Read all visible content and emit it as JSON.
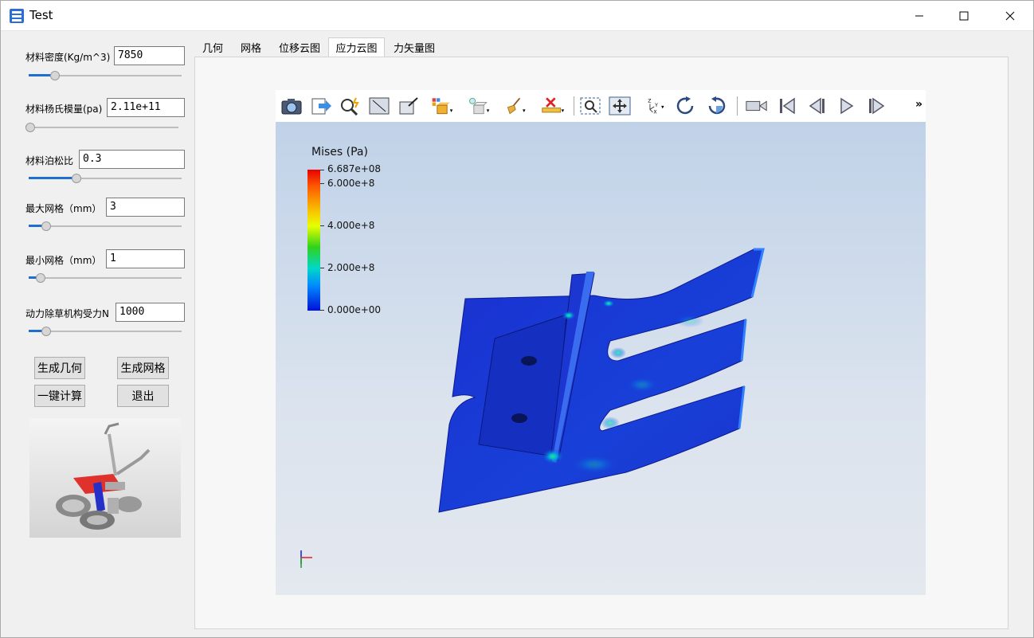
{
  "window": {
    "title": "Test"
  },
  "left_panel": {
    "density": {
      "label": "材料密度(Kg/m^3)",
      "value": "7850",
      "slider": 0.15
    },
    "young": {
      "label": "材料杨氏模量(pa)",
      "value": "2.11e+11",
      "slider": 0.0
    },
    "poisson": {
      "label": "材料泊松比",
      "value": "0.3",
      "slider": 0.3
    },
    "max_mesh": {
      "label": "最大网格（mm）",
      "value": "3",
      "slider": 0.09
    },
    "min_mesh": {
      "label": "最小网格（mm）",
      "value": "1",
      "slider": 0.05
    },
    "force": {
      "label": "动力除草机构受力N",
      "value": "1000",
      "slider": 0.09
    },
    "buttons": {
      "gen_geom": "生成几何",
      "gen_mesh": "生成网格",
      "compute": "一键计算",
      "exit": "退出"
    }
  },
  "tabs": [
    "几何",
    "网格",
    "位移云图",
    "应力云图",
    "力矢量图"
  ],
  "active_tab": "应力云图",
  "toolbar": {
    "icons": [
      "camera-icon",
      "export-icon",
      "zoom-magic-icon",
      "fit-frame-icon",
      "expand-frame-icon",
      "display-mode-icon",
      "lighting-icon",
      "broom-icon",
      "ruler-delete-icon",
      "zoom-box-icon",
      "pan-icon",
      "axes-icon",
      "rotate-cw-icon",
      "rotate-ccw-icon",
      "video-camera-icon",
      "skip-first-icon",
      "step-back-icon",
      "play-icon",
      "step-forward-icon"
    ],
    "more": "»"
  },
  "legend": {
    "title": "Mises (Pa)",
    "ticks": [
      "6.687e+08",
      "6.000e+8",
      "4.000e+8",
      "2.000e+8",
      "0.000e+00"
    ],
    "range": [
      0,
      668700000
    ],
    "colors": {
      "high": "#e80000",
      "mid": "#30d21c",
      "low": "#0010d8"
    }
  }
}
